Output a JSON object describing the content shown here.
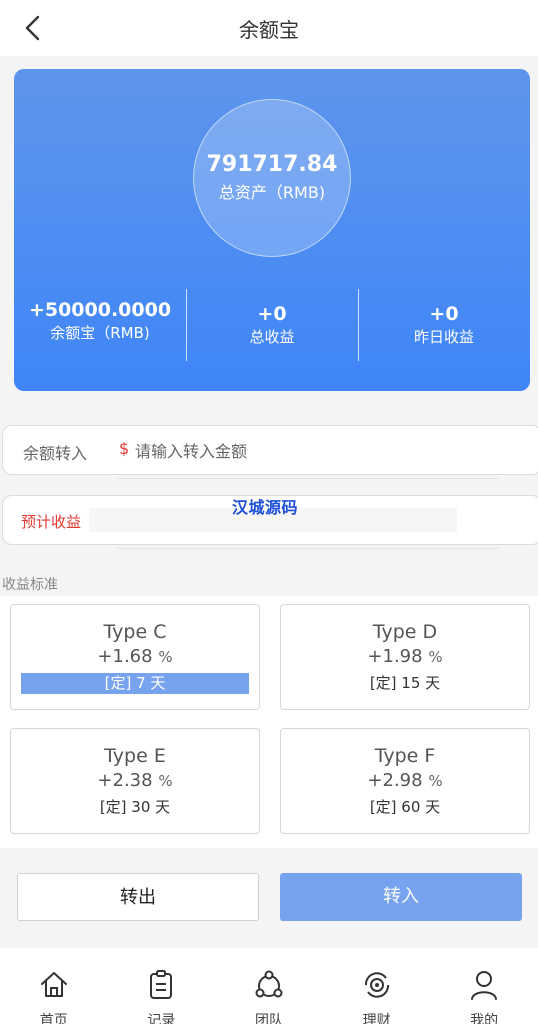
{
  "nav": {
    "title": "余额宝"
  },
  "summary": {
    "total_amount": "791717.84",
    "total_label": "总资产（RMB)",
    "stats": [
      {
        "value": "+50000.0000",
        "label": "余额宝（RMB)"
      },
      {
        "value": "+0",
        "label": "总收益"
      },
      {
        "value": "+0",
        "label": "昨日收益"
      }
    ]
  },
  "transfer": {
    "label": "余额转入",
    "currency": "$",
    "placeholder": "请输入转入金额",
    "value": ""
  },
  "estimate": {
    "label": "预计收益",
    "value": ""
  },
  "watermark": "汉城源码",
  "standards": {
    "label": "收益标准",
    "plans": [
      {
        "name": "Type C",
        "rate": "+1.68",
        "unit": "%",
        "term": "[定] 7 天",
        "selected": true
      },
      {
        "name": "Type D",
        "rate": "+1.98",
        "unit": "%",
        "term": "[定] 15 天",
        "selected": false
      },
      {
        "name": "Type E",
        "rate": "+2.38",
        "unit": "%",
        "term": "[定] 30 天",
        "selected": false
      },
      {
        "name": "Type F",
        "rate": "+2.98",
        "unit": "%",
        "term": "[定] 60 天",
        "selected": false
      }
    ]
  },
  "actions": {
    "out_label": "转出",
    "in_label": "转入"
  },
  "tabbar": [
    {
      "label": "首页",
      "icon": "home-icon"
    },
    {
      "label": "记录",
      "icon": "clipboard-icon"
    },
    {
      "label": "团队",
      "icon": "team-icon"
    },
    {
      "label": "理财",
      "icon": "finance-icon"
    },
    {
      "label": "我的",
      "icon": "user-icon"
    }
  ],
  "colors": {
    "primary": "#3f86f8",
    "accent_button": "#76a2ee",
    "warning_text": "#e53935"
  }
}
